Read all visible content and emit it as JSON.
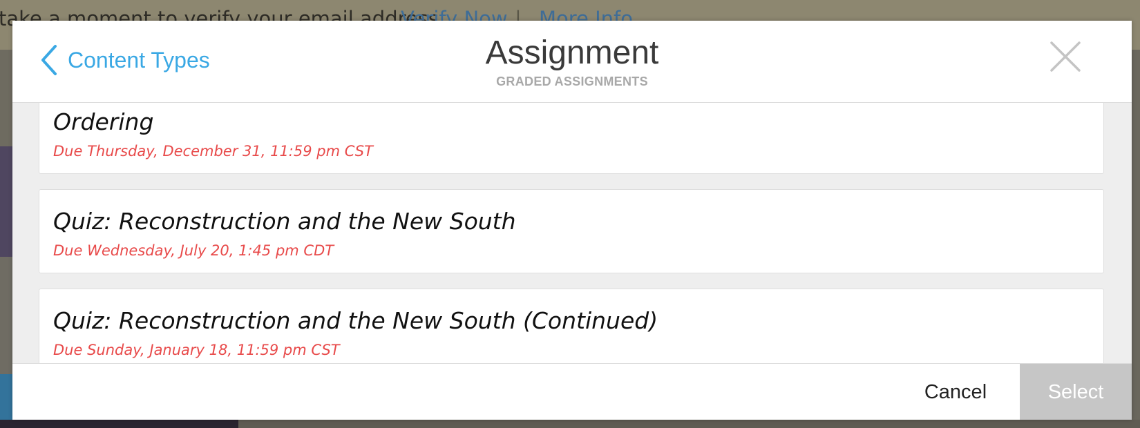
{
  "background": {
    "banner_text": "take a moment to verify your email address.",
    "verify_link": "Verify Now",
    "separator": "|",
    "more_info_link": "More Info"
  },
  "modal": {
    "back_label": "Content Types",
    "title": "Assignment",
    "subtitle": "GRADED ASSIGNMENTS",
    "items": [
      {
        "title": "Ordering",
        "due": "Due Thursday, December 31, 11:59 pm CST"
      },
      {
        "title": "Quiz: Reconstruction and the New South",
        "due": "Due Wednesday, July 20, 1:45 pm CDT"
      },
      {
        "title": "Quiz: Reconstruction and the New South (Continued)",
        "due": "Due Sunday, January 18, 11:59 pm CST"
      }
    ],
    "cancel_label": "Cancel",
    "select_label": "Select"
  },
  "icons": {
    "back": "chevron-left-icon",
    "close": "close-icon"
  },
  "colors": {
    "accent": "#3aa8e4",
    "due_text": "#e84a4a",
    "select_disabled": "#c6c6c6"
  }
}
